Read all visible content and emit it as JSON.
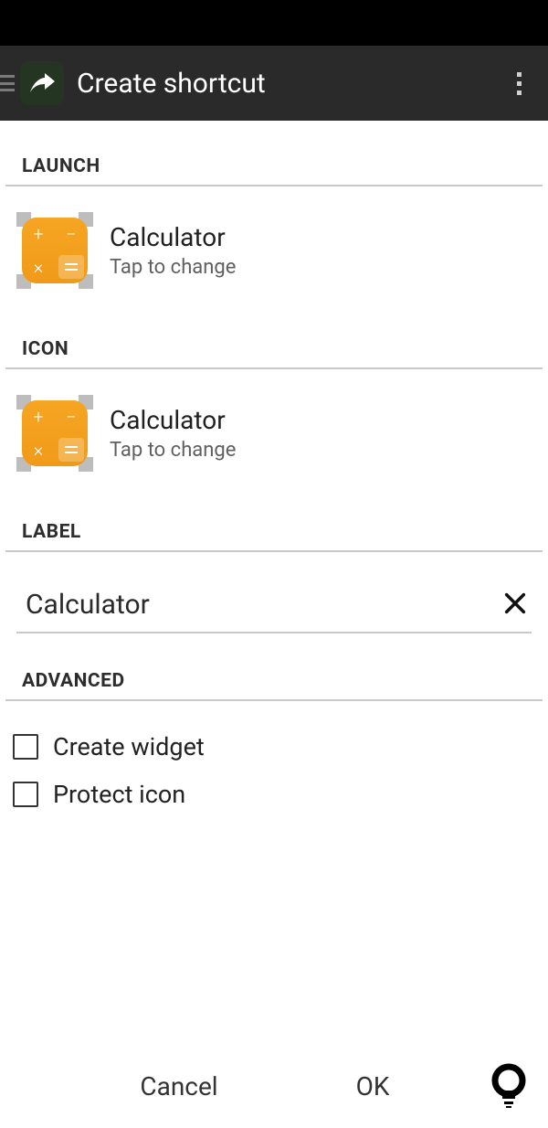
{
  "header": {
    "title": "Create shortcut"
  },
  "sections": {
    "launch": {
      "header": "LAUNCH",
      "item_title": "Calculator",
      "item_subtitle": "Tap to change"
    },
    "icon_section": {
      "header": "ICON",
      "item_title": "Calculator",
      "item_subtitle": "Tap to change"
    },
    "label_section": {
      "header": "LABEL",
      "input_value": "Calculator"
    },
    "advanced": {
      "header": "ADVANCED",
      "create_widget_label": "Create widget",
      "protect_icon_label": "Protect icon"
    }
  },
  "bottom": {
    "cancel": "Cancel",
    "ok": "OK"
  },
  "icons": {
    "app_icon": "share-arrow-icon",
    "overflow": "overflow-icon",
    "calculator": "calculator-icon",
    "clear": "close-icon",
    "hint": "lightbulb-icon",
    "hamburger": "hamburger-icon"
  }
}
